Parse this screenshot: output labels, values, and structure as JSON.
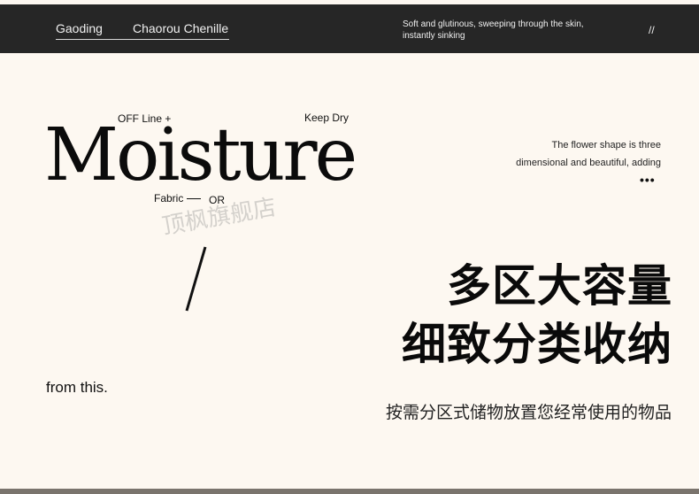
{
  "header": {
    "brand_left": "Gaoding",
    "brand_right": "Chaorou Chenille",
    "tagline_line1": "Soft and glutinous, sweeping through the skin,",
    "tagline_line2": "instantly sinking",
    "slashes": "//"
  },
  "hero": {
    "off_line": "OFF Line  +",
    "keep_dry": "Keep Dry",
    "title": "Moisture",
    "fabric": "Fabric",
    "or": "OR",
    "desc_line1": "The flower shape is three",
    "desc_line2": "dimensional and beautiful, adding",
    "dots": "•••",
    "watermark": "顶枫旗舰店"
  },
  "headline": {
    "line1": "多区大容量",
    "line2": "细致分类收纳"
  },
  "from_text": "from this.",
  "subtitle": "按需分区式储物放置您经常使用的物品"
}
